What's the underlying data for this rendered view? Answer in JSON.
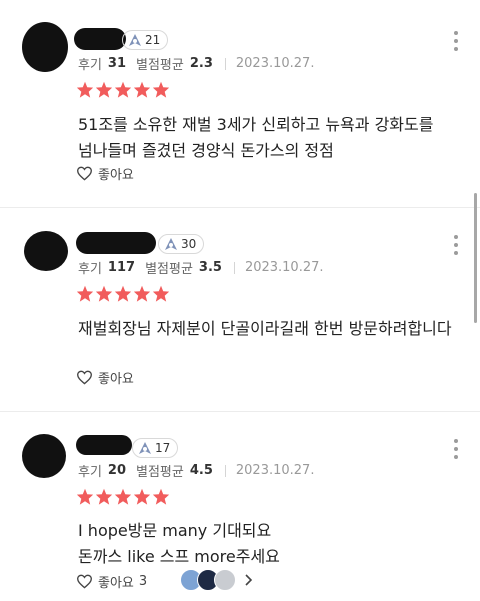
{
  "reviews": [
    {
      "level": "21",
      "review_label": "후기",
      "review_count": "31",
      "rating_label": "별점평균",
      "rating_avg": "2.3",
      "date": "2023.10.27.",
      "stars": 5,
      "text": "51조를 소유한 재벌 3세가 신뢰하고 뉴욕과 강화도를 넘나들며 즐겼던 경양식 돈가스의 정점",
      "like_label": "좋아요",
      "like_count": ""
    },
    {
      "level": "30",
      "review_label": "후기",
      "review_count": "117",
      "rating_label": "별점평균",
      "rating_avg": "3.5",
      "date": "2023.10.27.",
      "stars": 5,
      "text": "재벌회장님 자제분이 단골이라길래 한번 방문하려합니다",
      "like_label": "좋아요",
      "like_count": ""
    },
    {
      "level": "17",
      "review_label": "후기",
      "review_count": "20",
      "rating_label": "별점평균",
      "rating_avg": "4.5",
      "date": "2023.10.27.",
      "stars": 5,
      "text": "I hope방문 many 기대되요\n돈까스 like 스프 more주세요",
      "like_label": "좋아요",
      "like_count": "3"
    }
  ],
  "colors": {
    "star": "#f15c5c",
    "meta_gray": "#666666",
    "date_gray": "#999999"
  },
  "icons": [
    "level-badge-icon",
    "star-icon",
    "heart-outline-icon",
    "more-vertical-icon",
    "chevron-right-icon"
  ]
}
